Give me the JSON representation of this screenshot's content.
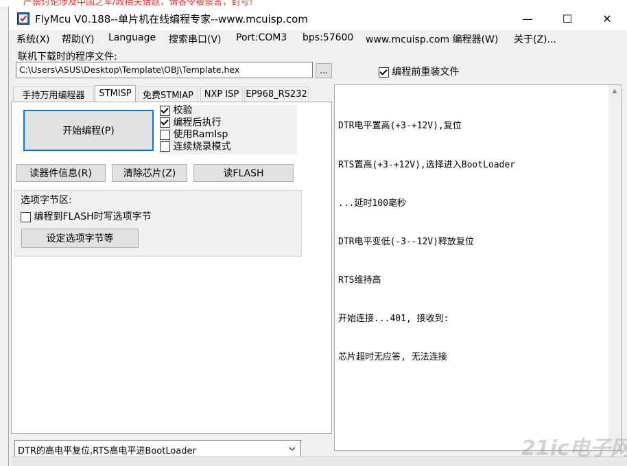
{
  "window": {
    "title": "FlyMcu V0.188--单片机在线编程专家--www.mcuisp.com",
    "minimize_glyph": "—",
    "maximize_glyph": "☐",
    "close_glyph": "✕"
  },
  "menu": [
    "系统(X)",
    "帮助(Y)",
    "Language",
    "搜索串口(V)",
    "Port:COM3",
    "bps:57600",
    "www.mcuisp.com 编程器(W)",
    "关于(Z)..."
  ],
  "file": {
    "label": "联机下载时的程序文件:",
    "path": "C:\\Users\\ASUS\\Desktop\\Template\\OBJ\\Template.hex",
    "browse": "...",
    "reload_label": "编程前重装文件",
    "reload_checked": true
  },
  "tabs": [
    "手持万用编程器",
    "STMISP",
    "免费STMIAP",
    "NXP ISP",
    "EP968_RS232"
  ],
  "stmisp": {
    "start": "开始编程(P)",
    "options": [
      {
        "label": "校验",
        "checked": true
      },
      {
        "label": "编程后执行",
        "checked": true
      },
      {
        "label": "使用RamIsp",
        "checked": false
      },
      {
        "label": "连续烧录模式",
        "checked": false
      }
    ],
    "read_info": "读器件信息(R)",
    "erase": "清除芯片(Z)",
    "read_flash": "读FLASH",
    "option_bytes": {
      "legend": "选项字节区:",
      "write_label": "编程到FLASH时写选项字节",
      "write_checked": false,
      "setup": "设定选项字节等"
    }
  },
  "reset_mode": "DTR的高电平复位,RTS高电平进BootLoader",
  "log": [
    "DTR电平置高(+3-+12V),复位",
    "RTS置高(+3-+12V),选择进入BootLoader",
    "...延时100毫秒",
    "DTR电平变低(-3--12V)释放复位",
    "RTS维持高",
    "开始连接...401, 接收到:",
    "芯片超时无应答, 无法连接"
  ],
  "background_text": "严禁讨论涉及中国之军/政相关话题，请各令被禁言，封号!",
  "watermark": "21ic电子网"
}
